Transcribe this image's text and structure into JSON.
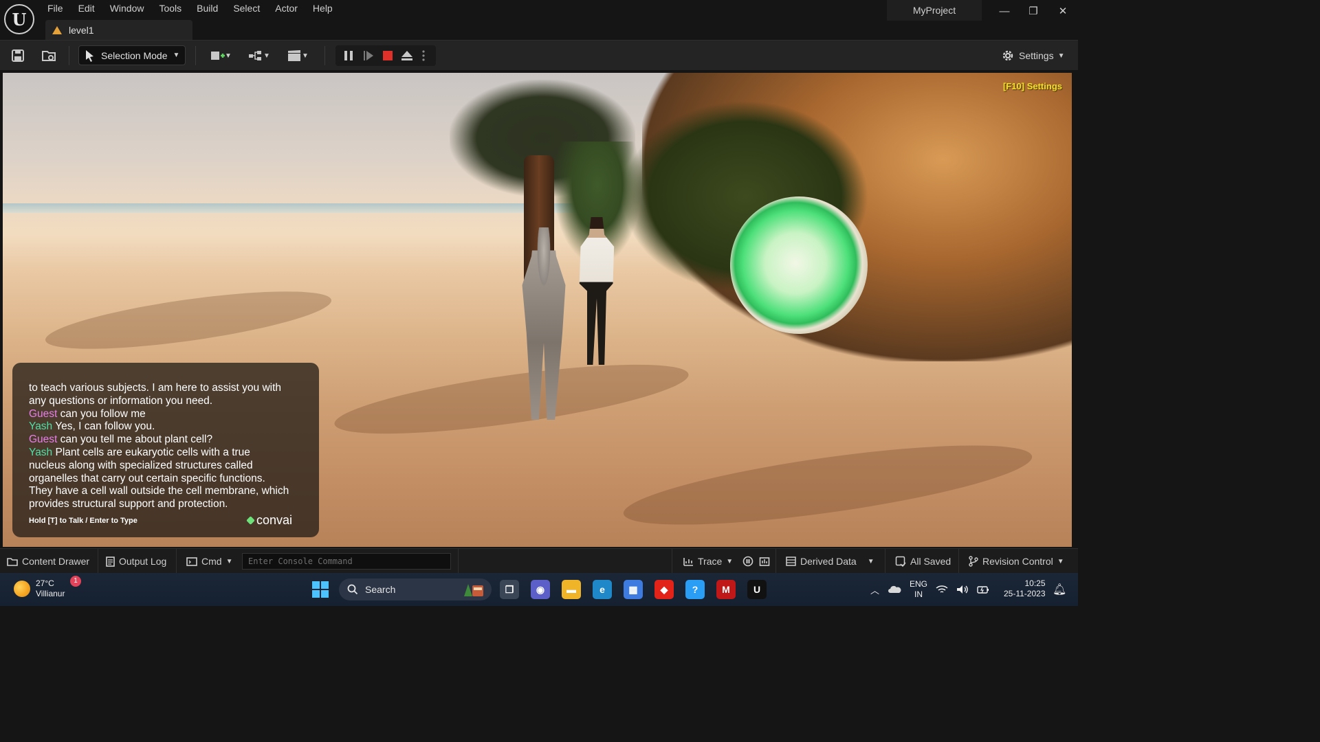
{
  "titlebar": {
    "logo_glyph": "U",
    "menu": [
      "File",
      "Edit",
      "Window",
      "Tools",
      "Build",
      "Select",
      "Actor",
      "Help"
    ],
    "document_tab": "level1",
    "project_name": "MyProject",
    "window_controls": {
      "minimize": "—",
      "restore": "❐",
      "close": "✕"
    }
  },
  "toolbar": {
    "selection_mode_label": "Selection Mode",
    "settings_label": "Settings",
    "icons": [
      "save-icon",
      "content-browser-icon",
      "add-actor-icon",
      "blueprint-icon",
      "cinematics-icon",
      "pause-icon",
      "skip-frame-icon",
      "stop-icon",
      "eject-icon",
      "more-options-icon",
      "settings-gear-icon"
    ],
    "stop_color": "#e0302a"
  },
  "viewport": {
    "settings_hint": "[F10] Settings",
    "chat": {
      "lines": [
        {
          "speaker": "",
          "text": "to teach various subjects.  I am here to assist you with"
        },
        {
          "speaker": "",
          "text": "any questions or information you need."
        },
        {
          "speaker": "Guest",
          "text": "can you follow me"
        },
        {
          "speaker": "Yash",
          "text": " Yes, I can follow you."
        },
        {
          "speaker": "Guest",
          "text": "can you tell me about plant cell?"
        },
        {
          "speaker": "Yash",
          "text": " Plant cells are eukaryotic cells with a true"
        },
        {
          "speaker": "",
          "text": "nucleus along with specialized structures called"
        },
        {
          "speaker": "",
          "text": "organelles that carry out certain specific functions."
        },
        {
          "speaker": "",
          "text": "They have a cell wall outside the cell membrane, which"
        },
        {
          "speaker": "",
          "text": "provides structural support and protection."
        }
      ],
      "hint": "Hold [T] to Talk / Enter to Type",
      "brand": "convai",
      "guest_color": "#e87ee8",
      "yash_color": "#4ee0a6"
    }
  },
  "statusbar": {
    "content_drawer": "Content Drawer",
    "output_log": "Output Log",
    "cmd": "Cmd",
    "console_placeholder": "Enter Console Command",
    "trace": "Trace",
    "derived_data": "Derived Data",
    "all_saved": "All Saved",
    "revision_control": "Revision Control"
  },
  "taskbar": {
    "weather_temp": "27°C",
    "weather_location": "Villianur",
    "notification_count": "1",
    "search_label": "Search",
    "apps": [
      {
        "name": "task-view-icon",
        "glyph": "❐",
        "color": "#3a4556"
      },
      {
        "name": "teams-chat-icon",
        "glyph": "◉",
        "color": "#5b5fc7"
      },
      {
        "name": "file-explorer-icon",
        "glyph": "▬",
        "color": "#f0b429"
      },
      {
        "name": "edge-icon",
        "glyph": "e",
        "color": "#1e88c8"
      },
      {
        "name": "microsoft-store-icon",
        "glyph": "▦",
        "color": "#3d7be0"
      },
      {
        "name": "anydesk-icon",
        "glyph": "◆",
        "color": "#e2231a"
      },
      {
        "name": "help-icon",
        "glyph": "?",
        "color": "#2a9df4"
      },
      {
        "name": "mcafee-icon",
        "glyph": "M",
        "color": "#c01818"
      },
      {
        "name": "unreal-engine-icon",
        "glyph": "U",
        "color": "#111111"
      }
    ],
    "lang_top": "ENG",
    "lang_bottom": "IN",
    "time": "10:25",
    "date": "25-11-2023"
  }
}
